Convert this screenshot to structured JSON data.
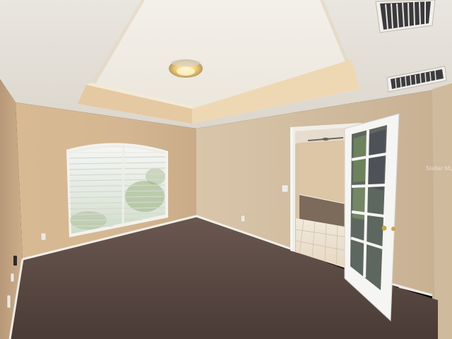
{
  "watermark": {
    "text": "Stellar MLS"
  },
  "scene": {
    "ceiling_light": "ceiling-light-icon",
    "ceiling_fan": "ceiling-fan-icon",
    "colors": {
      "wall": "#d8b891",
      "ceiling": "#ebe6dc",
      "carpet": "#5a4a44",
      "baseboard": "#f2efe9",
      "door": "#f5f5f3"
    }
  }
}
